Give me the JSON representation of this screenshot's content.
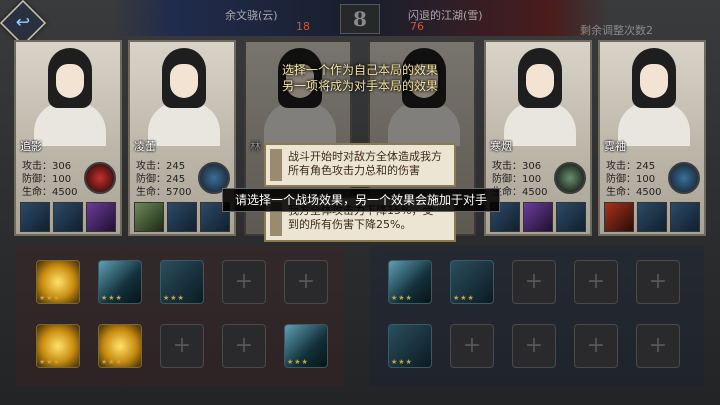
{
  "header": {
    "back_icon": "back-arrow-icon",
    "player1_name": "余文骁(云)",
    "player1_score": "18",
    "round_number": "8",
    "player2_name": "闪退的江湖(雪)",
    "player2_score": "76",
    "remaining_label": "剩余调整次数2"
  },
  "heroes": [
    {
      "name": "追影",
      "attack": "攻击：306",
      "defense": "防御：100",
      "hp": "生命：4500",
      "skill_icon": "red-wind-icon"
    },
    {
      "name": "凌蕾",
      "attack": "攻击：245",
      "defense": "防御：245",
      "hp": "生命：5700",
      "skill_icon": "blue-figure-icon"
    },
    {
      "name": "林",
      "attack": "",
      "defense": "",
      "hp": "",
      "skill_icon": ""
    },
    {
      "name": "",
      "attack": "",
      "defense": "",
      "hp": "",
      "skill_icon": ""
    },
    {
      "name": "寒烟",
      "attack": "攻击：306",
      "defense": "防御：100",
      "hp": "生命：4500",
      "skill_icon": "blue-figure-icon"
    },
    {
      "name": "霓袖",
      "attack": "攻击：245",
      "defense": "防御：100",
      "hp": "生命：4500",
      "skill_icon": "dagger-icon"
    }
  ],
  "overlay": {
    "hint_line1": "选择一个作为自己本局的效果",
    "hint_line2": "另一项将成为对手本局的效果",
    "effect1": "战斗开始时对敌方全体造成我方所有角色攻击力总和的伤害",
    "effect2_line1": "我方全体攻击力下降15%，受",
    "effect2_line2": "到的所有伤害下降25%。",
    "tooltip": "请选择一个战场效果，另一个效果会施加于对手"
  },
  "boards": {
    "left_slots": [
      "gold",
      "shadow",
      "sword",
      "empty",
      "empty",
      "gold",
      "gold",
      "empty",
      "empty",
      "shadow"
    ],
    "right_slots": [
      "shadow",
      "sword",
      "empty",
      "empty",
      "empty",
      "sword",
      "empty",
      "empty",
      "empty",
      "empty"
    ]
  },
  "colors": {
    "hint_text": "#f5e3a0",
    "effect_bg": "#ece5d4",
    "score_red": "#c35a3a"
  }
}
